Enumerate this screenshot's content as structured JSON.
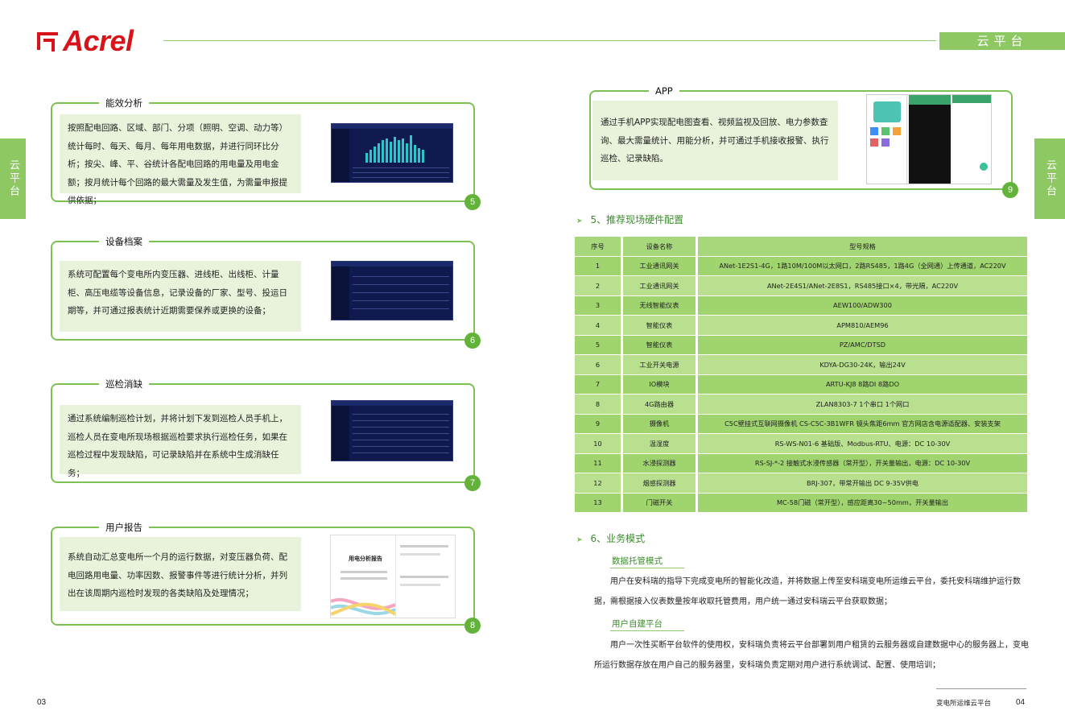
{
  "brand": {
    "name": "Acrel",
    "color": "#d7141a"
  },
  "header": {
    "tab_label": "云平台",
    "side_label": "云平台",
    "accent": "#8dc863"
  },
  "left_boxes": [
    {
      "title": "能效分析",
      "text": "按照配电回路、区域、部门、分项（照明、空调、动力等）统计每时、每天、每月、每年用电数据，并进行同环比分析；按尖、峰、平、谷统计各配电回路的用电量及用电金额；按月统计每个回路的最大需量及发生值，为需量申报提供依据；",
      "number": "5"
    },
    {
      "title": "设备档案",
      "text": "系统可配置每个变电所内变压器、进线柜、出线柜、计量柜、高压电缆等设备信息，记录设备的厂家、型号、投运日期等，并可通过报表统计近期需要保养或更换的设备；",
      "number": "6"
    },
    {
      "title": "巡检消缺",
      "text": "通过系统编制巡检计划，并将计划下发到巡检人员手机上，巡检人员在变电所现场根据巡检要求执行巡检任务，如果在巡检过程中发现缺陷，可记录缺陷并在系统中生成消缺任务；",
      "number": "7"
    },
    {
      "title": "用户报告",
      "text": "系统自动汇总变电所一个月的运行数据，对变压器负荷、配电回路用电量、功率因数、报警事件等进行统计分析，并列出在该周期内巡检时发现的各类缺陷及处理情况；",
      "number": "8",
      "report_title": "用电分析报告"
    }
  ],
  "app_box": {
    "title": "APP",
    "text": "通过手机APP实现配电图查看、视频监视及回放、电力参数查询、最大需量统计、用能分析，并可通过手机接收报警、执行巡检、记录缺陷。",
    "number": "9"
  },
  "hardware": {
    "heading": "5、推荐现场硬件配置",
    "columns": [
      "序号",
      "设备名称",
      "型号规格"
    ],
    "rows": [
      [
        "1",
        "工业通讯网关",
        "ANet-1E2S1-4G，1路10M/100M以太网口，2路RS485，1路4G（全网通）上传通道，AC220V"
      ],
      [
        "2",
        "工业通讯网关",
        "ANet-2E4S1/ANet-2E8S1，RS485接口×4，带光隔，AC220V"
      ],
      [
        "3",
        "无线智能仪表",
        "AEW100/ADW300"
      ],
      [
        "4",
        "智能仪表",
        "APM810/AEM96"
      ],
      [
        "5",
        "智能仪表",
        "PZ/AMC/DTSD"
      ],
      [
        "6",
        "工业开关电源",
        "KDYA-DG30-24K，输出24V"
      ],
      [
        "7",
        "IO模块",
        "ARTU-KJ8  8路DI  8路DO"
      ],
      [
        "8",
        "4G路由器",
        "ZLAN8303-7  1个串口 1个网口"
      ],
      [
        "9",
        "摄像机",
        "C5C壁挂式互联网摄像机 CS-C5C-3B1WFR 镜头焦距6mm 官方网店含电源适配器、安装支架"
      ],
      [
        "10",
        "温湿度",
        "RS-WS-N01-6 基础版、Modbus-RTU、电源：DC 10-30V"
      ],
      [
        "11",
        "水浸探测器",
        "RS-SJ-*-2 接触式水浸传感器（常开型），开关量输出，电源：DC 10-30V"
      ],
      [
        "12",
        "烟感探测器",
        "BRJ-307，带常开输出  DC 9-35V供电"
      ],
      [
        "13",
        "门磁开关",
        "MC-58门磁（常开型），感应距离30~50mm，开关量输出"
      ]
    ]
  },
  "business": {
    "heading": "6、业务模式",
    "modes": [
      {
        "title": "数据托管模式",
        "text": "用户在安科瑞的指导下完成变电所的智能化改造，并将数据上传至安科瑞变电所运维云平台，委托安科瑞维护运行数据，需根据接入仪表数量按年收取托管费用，用户统一通过安科瑞云平台获取数据；"
      },
      {
        "title": "用户自建平台",
        "text": "用户一次性买断平台软件的使用权，安科瑞负责将云平台部署到用户租赁的云服务器或自建数据中心的服务器上，变电所运行数据存放在用户自己的服务器里，安科瑞负责定期对用户进行系统调试、配置、使用培训；"
      }
    ]
  },
  "footer": {
    "left_page": "03",
    "right_page": "04",
    "right_text": "变电所运维云平台"
  }
}
